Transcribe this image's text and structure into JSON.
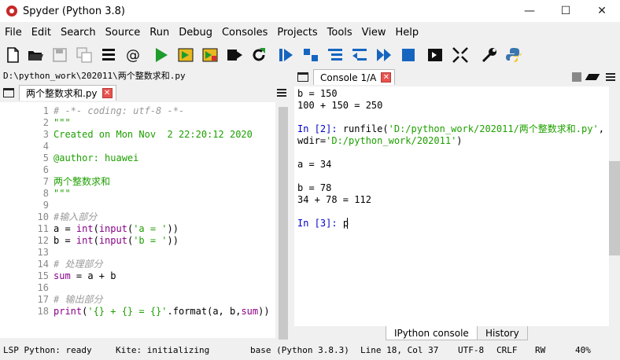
{
  "window": {
    "title": "Spyder (Python 3.8)",
    "minimize": "—",
    "maximize": "☐",
    "close": "✕"
  },
  "menu": [
    "File",
    "Edit",
    "Search",
    "Source",
    "Run",
    "Debug",
    "Consoles",
    "Projects",
    "Tools",
    "View",
    "Help"
  ],
  "toolbar": [
    "new-file",
    "open-file",
    "save-file",
    "save-all",
    "browse-tabs",
    "at-sign",
    "run",
    "run-cell",
    "run-cell-advance",
    "run-selection",
    "run-again",
    "debug",
    "step",
    "step-into",
    "step-return",
    "continue",
    "stop",
    "maximize-pane",
    "fullscreen",
    "preferences",
    "python-path"
  ],
  "path": "D:\\python_work\\202011\\两个整数求和.py",
  "editor": {
    "tab_label": "两个整数求和.py",
    "lines": [
      {
        "n": "1",
        "parts": [
          {
            "t": "# -*- coding: utf-8 -*-",
            "c": "comment"
          }
        ]
      },
      {
        "n": "2",
        "parts": [
          {
            "t": "\"\"\"",
            "c": "str"
          }
        ]
      },
      {
        "n": "3",
        "parts": [
          {
            "t": "Created on Mon Nov  2 22:20:12 2020",
            "c": "str"
          }
        ]
      },
      {
        "n": "4",
        "parts": []
      },
      {
        "n": "5",
        "parts": [
          {
            "t": "@author: huawei",
            "c": "str"
          }
        ]
      },
      {
        "n": "6",
        "parts": []
      },
      {
        "n": "7",
        "parts": [
          {
            "t": "两个整数求和",
            "c": "str"
          }
        ]
      },
      {
        "n": "8",
        "parts": [
          {
            "t": "\"\"\"",
            "c": "str"
          }
        ]
      },
      {
        "n": "9",
        "parts": []
      },
      {
        "n": "10",
        "parts": [
          {
            "t": "#输入部分",
            "c": "comment"
          }
        ]
      },
      {
        "n": "11",
        "parts": [
          {
            "t": "a = ",
            "c": "plain"
          },
          {
            "t": "int",
            "c": "builtin"
          },
          {
            "t": "(",
            "c": "plain"
          },
          {
            "t": "input",
            "c": "builtin"
          },
          {
            "t": "(",
            "c": "plain"
          },
          {
            "t": "'a = '",
            "c": "str"
          },
          {
            "t": "))",
            "c": "plain"
          }
        ]
      },
      {
        "n": "12",
        "parts": [
          {
            "t": "b = ",
            "c": "plain"
          },
          {
            "t": "int",
            "c": "builtin"
          },
          {
            "t": "(",
            "c": "plain"
          },
          {
            "t": "input",
            "c": "builtin"
          },
          {
            "t": "(",
            "c": "plain"
          },
          {
            "t": "'b = '",
            "c": "str"
          },
          {
            "t": "))",
            "c": "plain"
          }
        ]
      },
      {
        "n": "13",
        "parts": []
      },
      {
        "n": "14",
        "parts": [
          {
            "t": "# 处理部分",
            "c": "comment"
          }
        ]
      },
      {
        "n": "15",
        "parts": [
          {
            "t": "sum",
            "c": "builtin"
          },
          {
            "t": " = a + b",
            "c": "plain"
          }
        ]
      },
      {
        "n": "16",
        "parts": []
      },
      {
        "n": "17",
        "parts": [
          {
            "t": "# 输出部分",
            "c": "comment"
          }
        ]
      },
      {
        "n": "18",
        "parts": [
          {
            "t": "print",
            "c": "builtin"
          },
          {
            "t": "(",
            "c": "plain"
          },
          {
            "t": "'{} + {} = {}'",
            "c": "str"
          },
          {
            "t": ".format(a, b,",
            "c": "plain"
          },
          {
            "t": "sum",
            "c": "builtin"
          },
          {
            "t": ")",
            "c": "plain"
          },
          {
            "t": ")",
            "c": "plain"
          }
        ]
      }
    ]
  },
  "console": {
    "tab_label": "Console 1/A",
    "lines": [
      {
        "parts": [
          {
            "t": "b = 150",
            "c": "plain"
          }
        ]
      },
      {
        "parts": [
          {
            "t": "100 + 150 = 250",
            "c": "plain"
          }
        ]
      },
      {
        "parts": []
      },
      {
        "parts": [
          {
            "t": "In [",
            "c": "prompt"
          },
          {
            "t": "2",
            "c": "prompt"
          },
          {
            "t": "]: ",
            "c": "prompt"
          },
          {
            "t": "runfile(",
            "c": "plain"
          },
          {
            "t": "'D:/python_work/202011/两个整数求和.py'",
            "c": "str"
          },
          {
            "t": ",",
            "c": "plain"
          }
        ]
      },
      {
        "parts": [
          {
            "t": "wdir=",
            "c": "plain"
          },
          {
            "t": "'D:/python_work/202011'",
            "c": "str"
          },
          {
            "t": ")",
            "c": "plain"
          }
        ]
      },
      {
        "parts": []
      },
      {
        "parts": [
          {
            "t": "a = 34",
            "c": "plain"
          }
        ]
      },
      {
        "parts": []
      },
      {
        "parts": [
          {
            "t": "b = 78",
            "c": "plain"
          }
        ]
      },
      {
        "parts": [
          {
            "t": "34 + 78 = 112",
            "c": "plain"
          }
        ]
      },
      {
        "parts": []
      },
      {
        "parts": [
          {
            "t": "In [",
            "c": "prompt"
          },
          {
            "t": "3",
            "c": "prompt"
          },
          {
            "t": "]: ",
            "c": "prompt"
          },
          {
            "t": "p",
            "c": "plain"
          }
        ]
      }
    ],
    "bottom_tabs": [
      "IPython console",
      "History"
    ]
  },
  "status": {
    "lsp": "LSP Python: ready",
    "kite": "Kite: initializing",
    "env": "base (Python 3.8.3)",
    "cursor": "Line 18, Col 37",
    "encoding": "UTF-8",
    "eol": "CRLF",
    "rw": "RW",
    "mem": "40%"
  }
}
